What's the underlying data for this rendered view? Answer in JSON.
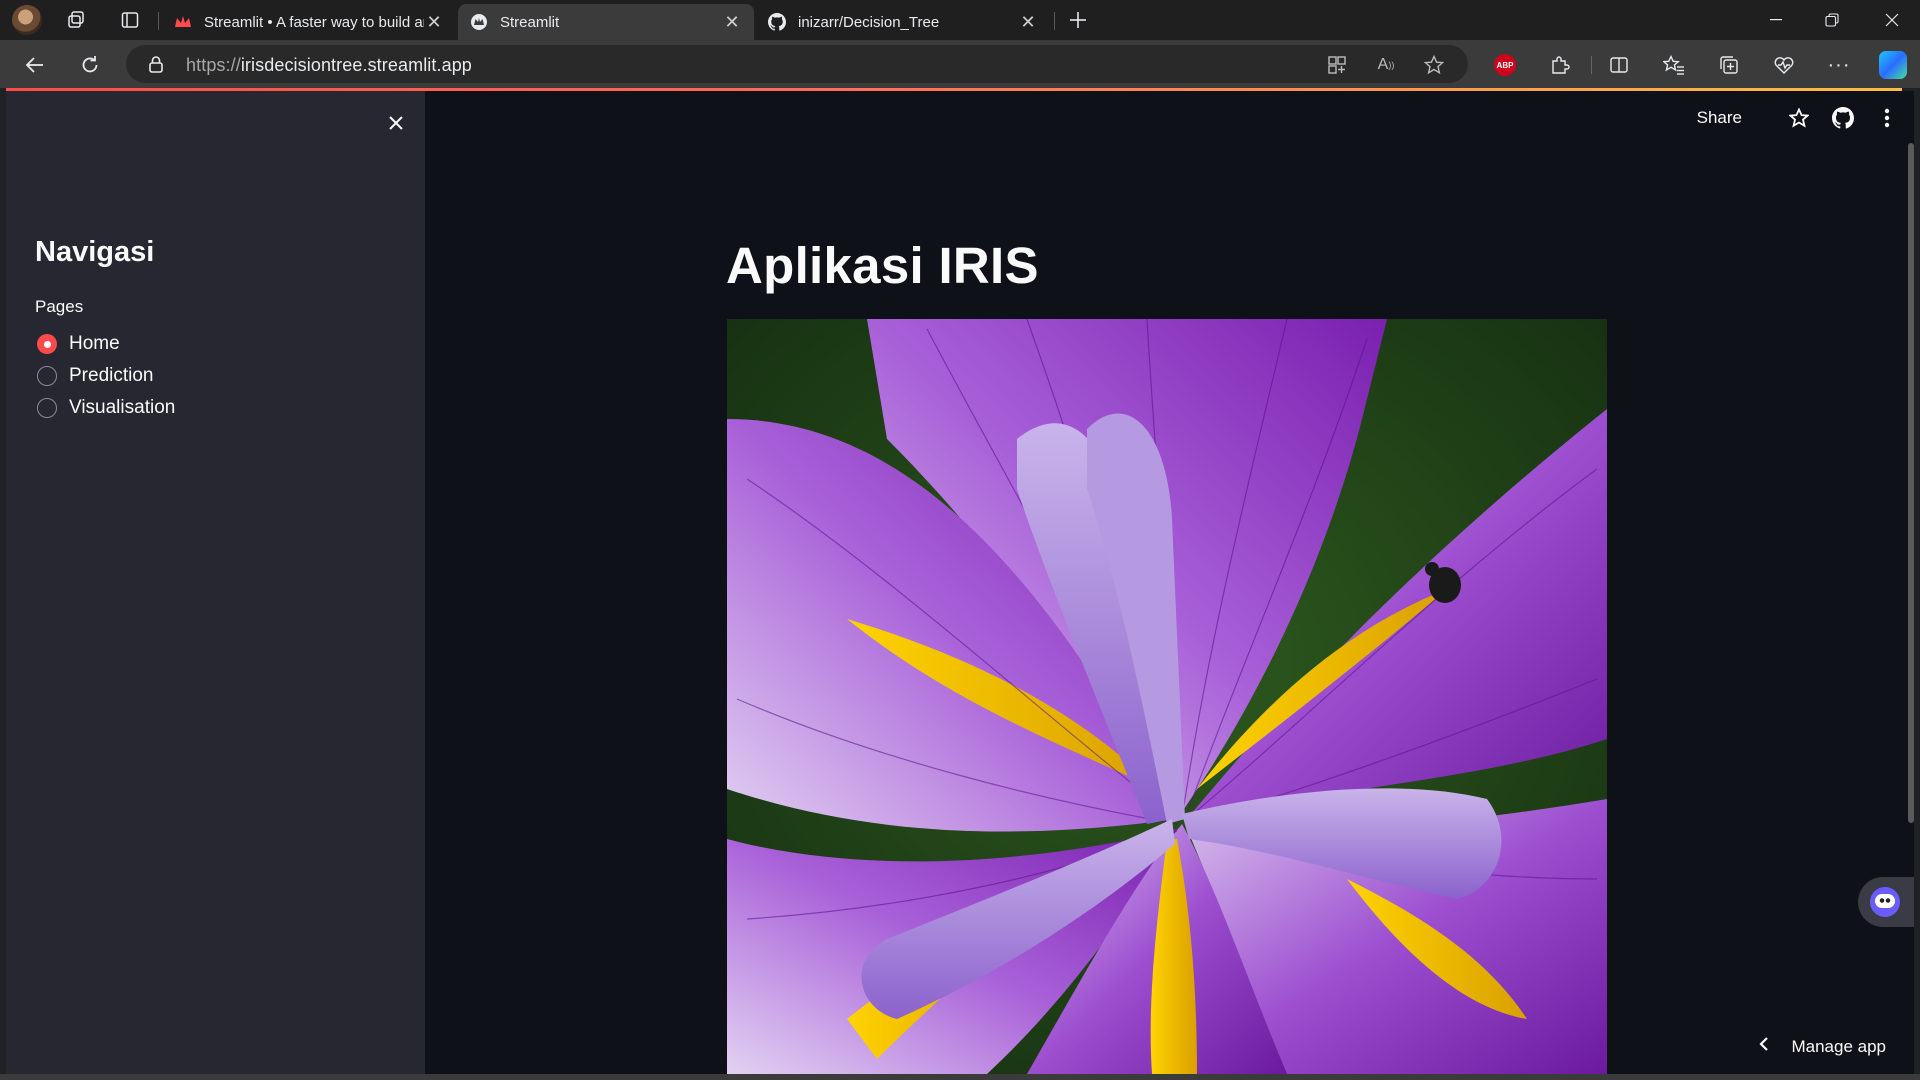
{
  "browser": {
    "tabs": [
      {
        "title": "Streamlit • A faster way to build and share data apps",
        "favicon": "streamlit-crown-icon",
        "active": false
      },
      {
        "title": "Streamlit",
        "favicon": "streamlit-icon",
        "active": true
      },
      {
        "title": "inizarr/Decision_Tree",
        "favicon": "github-icon",
        "active": false
      }
    ],
    "url_scheme": "https://",
    "url_host": "irisdecisiontree.streamlit.app",
    "extension_label": "ABP"
  },
  "sidebar": {
    "title": "Navigasi",
    "pages_label": "Pages",
    "options": [
      {
        "label": "Home",
        "selected": true
      },
      {
        "label": "Prediction",
        "selected": false
      },
      {
        "label": "Visualisation",
        "selected": false
      }
    ]
  },
  "header": {
    "share_label": "Share"
  },
  "main": {
    "title": "Aplikasi IRIS",
    "image_subject": "purple-iris-flower"
  },
  "footer": {
    "manage_label": "Manage app"
  },
  "colors": {
    "accent": "#ff4b4b",
    "app_bg": "#0e1117",
    "sidebar_bg": "#262730"
  }
}
